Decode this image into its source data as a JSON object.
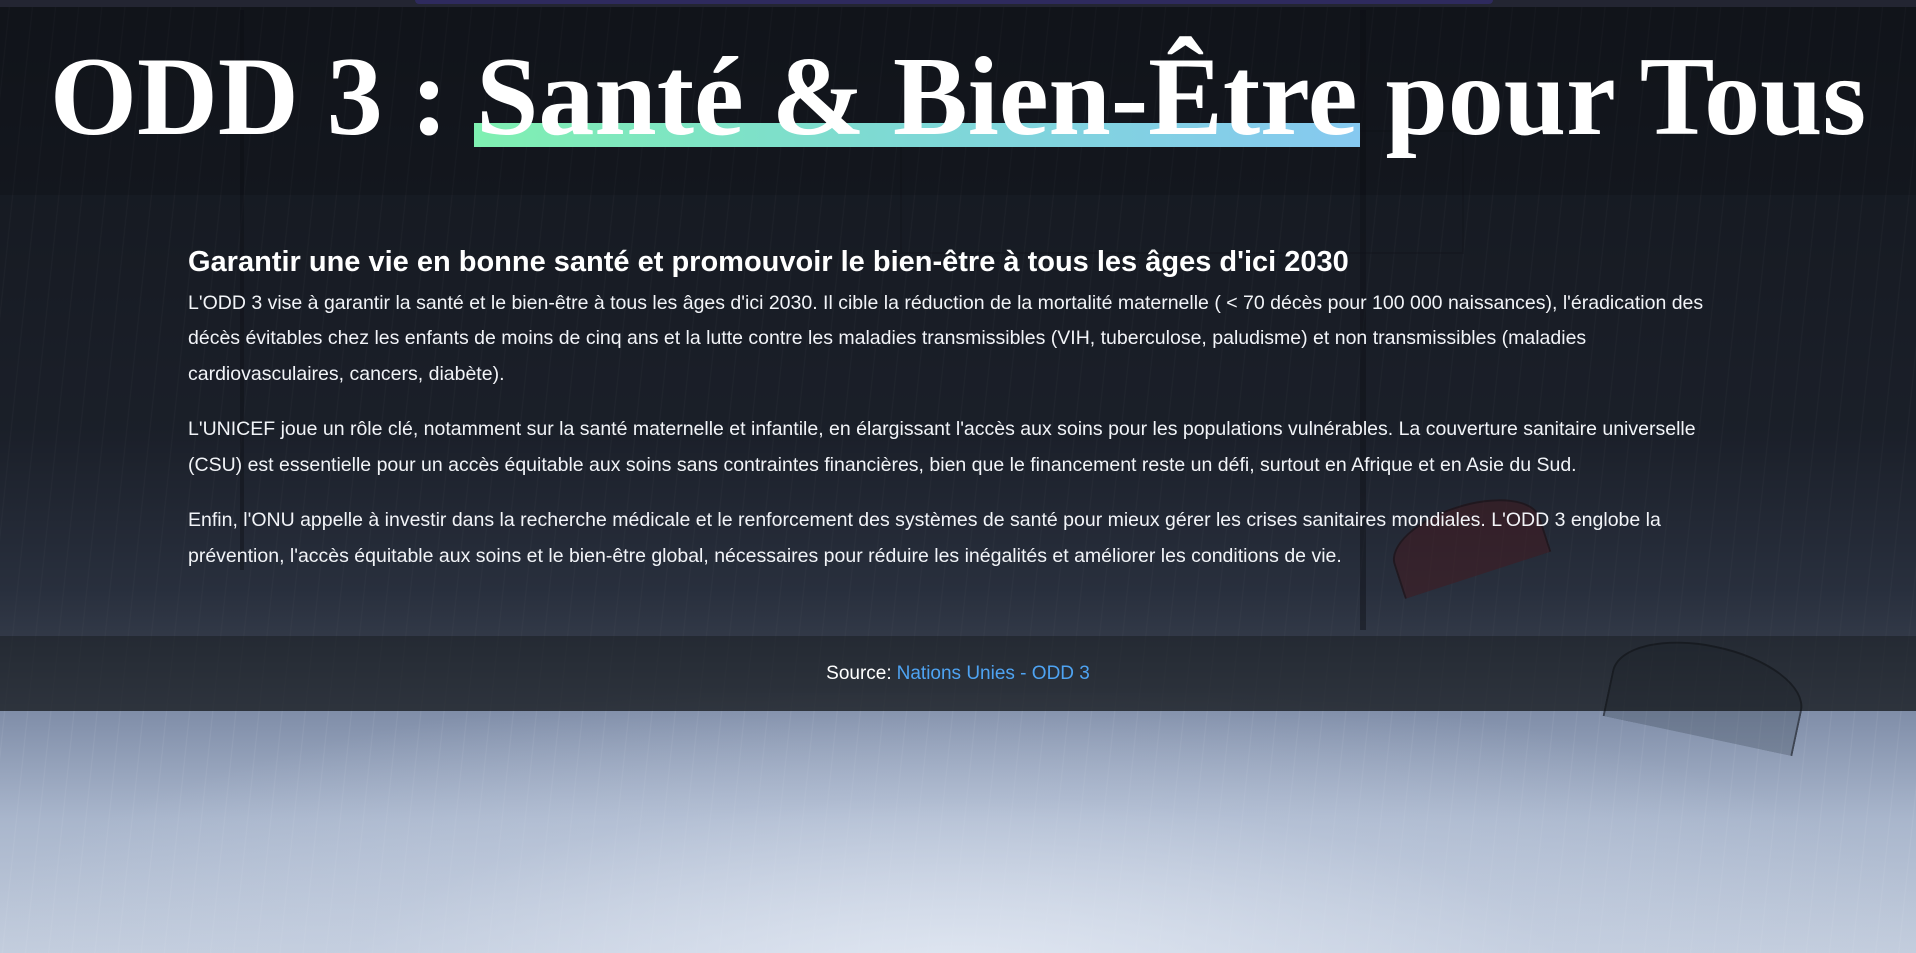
{
  "hero": {
    "title_prefix": "ODD 3 : ",
    "title_highlight": "Santé & Bien-Être",
    "title_suffix": " pour Tous"
  },
  "content": {
    "heading": "Garantir une vie en bonne santé et promouvoir le bien-être à tous les âges d'ici 2030",
    "paragraphs": [
      "L'ODD 3 vise à garantir la santé et le bien-être à tous les âges d'ici 2030. Il cible la réduction de la mortalité maternelle (  <  70 décès pour 100 000 naissances), l'éradication des décès évitables chez les enfants de moins de cinq ans et la lutte contre les maladies transmissibles (VIH, tuberculose, paludisme) et non transmissibles (maladies cardiovasculaires, cancers, diabète).",
      "L'UNICEF joue un rôle clé, notamment sur la santé maternelle et infantile, en élargissant l'accès aux soins pour les populations vulnérables. La couverture sanitaire universelle (CSU) est essentielle pour un accès équitable aux soins sans contraintes financières, bien que le financement reste un défi, surtout en Afrique et en Asie du Sud.",
      "Enfin, l'ONU appelle à investir dans la recherche médicale et le renforcement des systèmes de santé pour mieux gérer les crises sanitaires mondiales. L'ODD 3 englobe la prévention, l'accès équitable aux soins et le bien-être global, nécessaires pour réduire les inégalités et améliorer les conditions de vie."
    ]
  },
  "footer": {
    "source_label": "Source:",
    "source_link": "Nations Unies - ODD 3"
  },
  "colors": {
    "highlight_gradient": [
      "#7ff0b1",
      "#86c9f0"
    ],
    "link": "#4ea3f2"
  }
}
